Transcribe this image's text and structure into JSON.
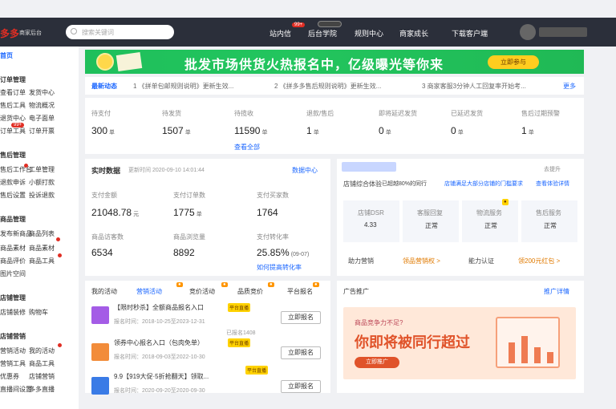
{
  "topbar": {
    "logo": "多多",
    "logo_sub": "商家后台",
    "search_placeholder": "搜索关键词",
    "nav": [
      "站内信",
      "后台学院",
      "规则中心",
      "商家成长",
      "下载客户端"
    ],
    "badge_msg": "99+"
  },
  "sidebar": {
    "home": "首页",
    "sections": [
      {
        "head": "订单管理",
        "items": [
          "查看订单",
          "发货中心",
          "售后工具",
          "物流概况",
          "退货中心",
          "电子面单",
          "订单工具",
          "订单开票"
        ]
      },
      {
        "head": "售后管理",
        "items": [
          "售后工作台",
          "工单管理",
          "退款申诉",
          "小额打款",
          "售后设置",
          "投诉退款"
        ]
      },
      {
        "head": "商品管理",
        "items": [
          "发布新商品",
          "商品列表",
          "商品素材",
          "商品素材",
          "商品评价",
          "商品工具",
          "图片空间"
        ]
      },
      {
        "head": "店铺管理",
        "items": [
          "店铺装修",
          "购物车"
        ]
      },
      {
        "head": "店铺营销",
        "items": [
          "营销活动",
          "我的活动",
          "营销工具",
          "商品工具",
          "优惠券",
          "店铺营销",
          "直播间设置",
          "多多直播"
        ]
      }
    ]
  },
  "banner": {
    "text": "批发市场供货火热报名中，亿级曝光等你来",
    "button": "立即参与"
  },
  "notice": {
    "label": "最新动态",
    "items": [
      "1 《拼单包邮规则说明》更新生效...",
      "2 《拼多多售后规则说明》更新生效...",
      "3 商家客服3分钟人工回复率开始考..."
    ],
    "more": "更多"
  },
  "stats": {
    "items": [
      {
        "label": "待支付",
        "value": "300",
        "unit": "单"
      },
      {
        "label": "待发货",
        "value": "1507",
        "unit": "单"
      },
      {
        "label": "待揽收",
        "value": "11590",
        "unit": "单"
      },
      {
        "label": "退款/售后",
        "value": "1",
        "unit": "单"
      },
      {
        "label": "即将延迟发货",
        "value": "0",
        "unit": "单"
      },
      {
        "label": "已延迟发货",
        "value": "0",
        "unit": "单"
      },
      {
        "label": "售后过期预警",
        "value": "1",
        "unit": "单"
      }
    ],
    "view_all": "查看全部"
  },
  "realtime": {
    "title": "实时数据",
    "update_time": "更新时间 2020-09-10 14:01:44",
    "center_link": "数据中心",
    "items": [
      {
        "label": "支付金额",
        "value": "21048.78",
        "unit": "元"
      },
      {
        "label": "支付订单数",
        "value": "1775",
        "unit": "单"
      },
      {
        "label": "支付买家数",
        "value": "1764",
        "unit": ""
      },
      {
        "label": "商品访客数",
        "value": "6534",
        "unit": ""
      },
      {
        "label": "商品浏览量",
        "value": "8892",
        "unit": ""
      },
      {
        "label": "支付转化率",
        "value": "25.85%",
        "unit": "(09-07)"
      }
    ],
    "improve_link": "如何提高转化率"
  },
  "shop": {
    "more": "去提升",
    "line1": "店铺综合体验",
    "line2": "已超越80%的同行",
    "link1": "店铺满足大部分店铺的门槛要求",
    "link2": "查看体验详情",
    "metrics": [
      {
        "label": "店铺DSR",
        "value": "4.33"
      },
      {
        "label": "客服回复",
        "value": "正常"
      },
      {
        "label": "物流服务",
        "value": "正常"
      },
      {
        "label": "售后服务",
        "value": "正常"
      }
    ],
    "row": [
      "助力营销",
      "领品营销权 >",
      "能力认证",
      "领200元红包 >"
    ]
  },
  "activities": {
    "tabs": [
      "我的活动",
      "营销活动",
      "竞价活动",
      "品质竞价",
      "平台报名"
    ],
    "rows": [
      {
        "title": "【限时秒杀】全额商品报名入口",
        "tag": "平台直播",
        "time": "报名时间：2018-10-25至2023-12-31",
        "button": "立即报名"
      },
      {
        "title": "领券中心报名入口（包肉免单）",
        "tag": "已报名1408",
        "time": "报名时间：2018-09-03至2022-10-30",
        "button": "立即报名"
      },
      {
        "title": "9.9【919大促·5折抢翻天】领取...",
        "tag": "平台直播",
        "time": "报名时间：2020-09-20至2020-09-30",
        "button": "立即报名"
      }
    ],
    "tag_label": "平台直播"
  },
  "ad": {
    "title": "广告推广",
    "detail": "推广详情",
    "small": "商品竞争力不足?",
    "big": "你即将被同行超过",
    "button": "立即推广"
  }
}
